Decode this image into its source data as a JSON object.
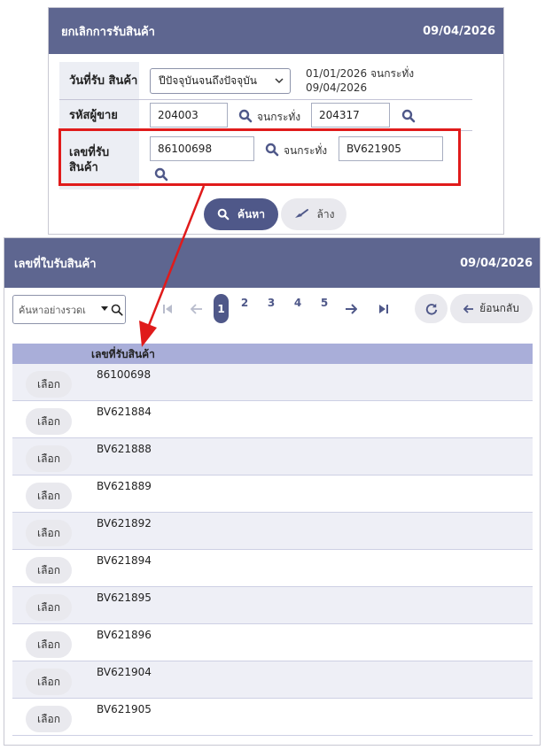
{
  "form": {
    "title": "ยกเลิกการรับสินค้า",
    "date": "09/04/2026",
    "receive_date": {
      "label": "วันที่รับ สินค้า",
      "select_value": "ปีปัจจุบันจนถึงปัจจุบัน",
      "range_line1": "01/01/2026 จนกระทั่ง",
      "range_line2": "09/04/2026"
    },
    "seller_code": {
      "label": "รหัสผู้ขาย",
      "from": "204003",
      "to_label": "จนกระทั่ง",
      "to": "204317"
    },
    "receipt_no": {
      "label": "เลขที่รับ สินค้า",
      "from": "86100698",
      "to_label": "จนกระทั่ง",
      "to": "BV621905"
    },
    "search_label": "ค้นหา",
    "clear_label": "ล้าง"
  },
  "lookup": {
    "title": "เลขที่ใบรับสินค้า",
    "date": "09/04/2026",
    "search_placeholder": "ค้นหาอย่างรวดเ",
    "pages": [
      "1",
      "2",
      "3",
      "4",
      "5"
    ],
    "current_page": "1",
    "back_label": "ย้อนกลับ",
    "column_header": "เลขที่รับสินค้า",
    "select_label": "เลือก",
    "rows": [
      "86100698",
      "BV621884",
      "BV621888",
      "BV621889",
      "BV621892",
      "BV621894",
      "BV621895",
      "BV621896",
      "BV621904",
      "BV621905"
    ]
  },
  "colors": {
    "header_bg": "#5e6690",
    "primary_button": "#4f5889",
    "table_header": "#a9aed9",
    "highlight_border": "#e01b1b"
  },
  "icons": [
    "search-icon",
    "chevron-down-icon",
    "broom-icon",
    "first-page-icon",
    "prev-page-icon",
    "next-page-icon",
    "last-page-icon",
    "refresh-icon",
    "back-arrow-icon",
    "arrow-annotation"
  ]
}
